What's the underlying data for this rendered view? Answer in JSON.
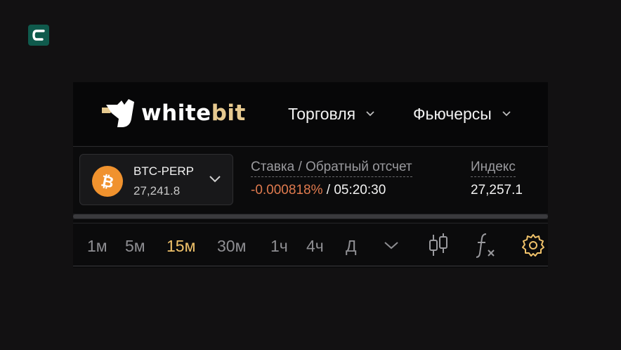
{
  "corner_badge": {
    "icon": "c-logo-icon",
    "color": "#0f5a4c"
  },
  "header": {
    "logo": {
      "part1": "white",
      "part2": "bit"
    },
    "nav": [
      {
        "label": "Торговля",
        "icon": "chevron-down-icon"
      },
      {
        "label": "Фьючерсы",
        "icon": "chevron-down-icon"
      }
    ]
  },
  "ticker": {
    "pair": "BTC-PERP",
    "price": "27,241.8",
    "coin_icon": "bitcoin-icon",
    "rate_label": "Ставка / Обратный отсчет",
    "rate_value": "-0.000818%",
    "rate_separator": " / ",
    "countdown": "05:20:30",
    "index_label": "Индекс",
    "index_value": "27,257.1"
  },
  "toolbar": {
    "intervals": [
      {
        "label": "1м",
        "active": false
      },
      {
        "label": "5м",
        "active": false
      },
      {
        "label": "15м",
        "active": true
      },
      {
        "label": "30м",
        "active": false
      },
      {
        "label": "1ч",
        "active": false
      },
      {
        "label": "4ч",
        "active": false
      },
      {
        "label": "Д",
        "active": false
      }
    ],
    "icons": [
      "chevron-down-icon",
      "candles-icon",
      "indicators-icon",
      "settings-icon"
    ]
  },
  "colors": {
    "accent": "#f0c26a",
    "negative": "#e07a4e",
    "bitcoin": "#f0922e",
    "logo_accent": "#e6c98f"
  }
}
